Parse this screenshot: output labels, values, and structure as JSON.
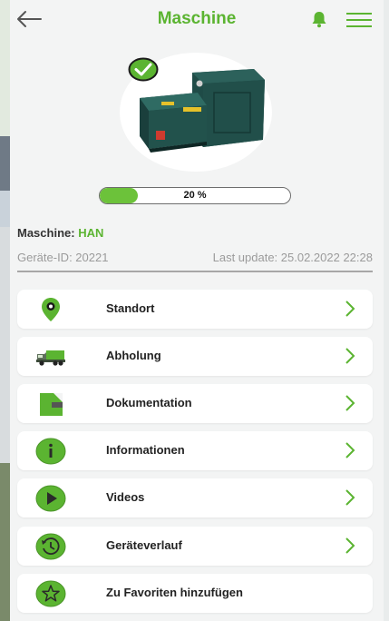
{
  "header": {
    "title": "Maschine",
    "back_icon": "arrow-left-icon",
    "bell_icon": "bell-icon",
    "menu_icon": "hamburger-menu-icon"
  },
  "machine": {
    "label": "Maschine:",
    "name": "HAN",
    "device_id": "Geräte-ID: 20221",
    "last_update": "Last update: 25.02.2022 22:28",
    "status_icon": "check-circle-icon"
  },
  "fill_level": {
    "percent": 20,
    "text": "20 %"
  },
  "menu": [
    {
      "label": "Standort",
      "icon": "location-pin-icon"
    },
    {
      "label": "Abholung",
      "icon": "truck-icon"
    },
    {
      "label": "Dokumentation",
      "icon": "document-icon"
    },
    {
      "label": "Informationen",
      "icon": "info-icon"
    },
    {
      "label": "Videos",
      "icon": "play-icon"
    },
    {
      "label": "Geräteverlauf",
      "icon": "history-icon"
    },
    {
      "label": "Zu Favoriten hinzufügen",
      "icon": "star-icon"
    }
  ],
  "colors": {
    "accent": "#5bb431",
    "icon_green": "#6cc23a",
    "background": "#f3f4f4"
  }
}
